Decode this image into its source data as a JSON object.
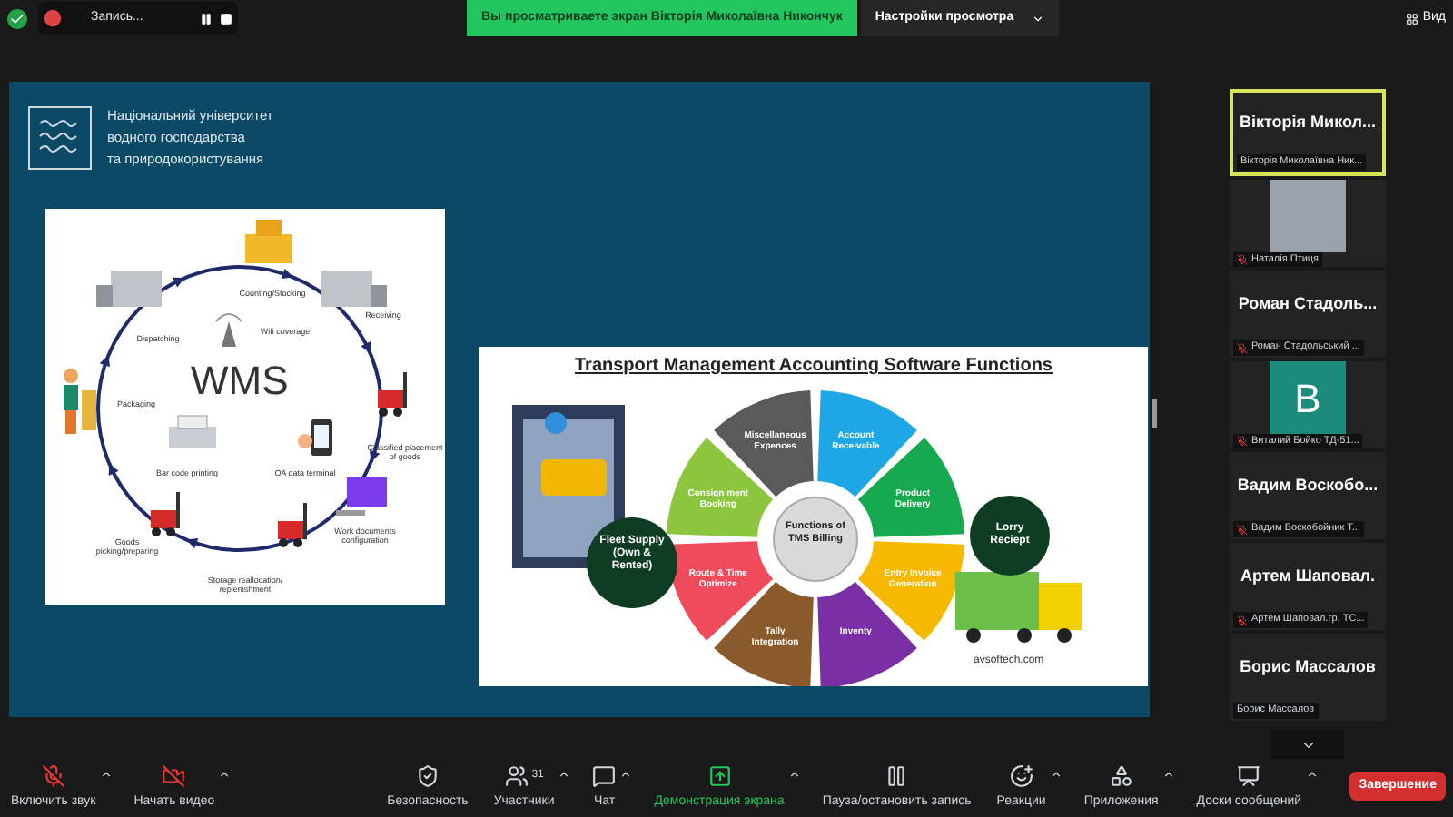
{
  "top_bar": {
    "recording": {
      "label": "Запись...",
      "paused": false
    },
    "banner": "Вы просматриваете экран Вікторія Миколаївна Никончук",
    "view_options": "Настройки просмотра",
    "view_button": "Вид"
  },
  "slide": {
    "university": [
      "Національний університет",
      "водного господарства",
      "та природокористування"
    ],
    "wms": {
      "title": "WMS",
      "labels": [
        "Counting/Stocking",
        "Receiving",
        "Wifi coverage",
        "Dispatching",
        "Packaging",
        "Classified placement of goods",
        "OA data terminal",
        "Bar code printing",
        "Work documents configuration",
        "Goods picking/preparing",
        "Storage reallocation/ replenishment"
      ]
    },
    "tms": {
      "title": "Transport Management Accounting Software Functions",
      "center": "Functions of TMS Billing",
      "segments": [
        {
          "label": "Miscellaneous Expences",
          "color": "#5a5a5a"
        },
        {
          "label": "Account Receivable",
          "color": "#1ea7e4"
        },
        {
          "label": "Consign ment Booking",
          "color": "#8cc63f"
        },
        {
          "label": "Product Delivery",
          "color": "#17a94f"
        },
        {
          "label": "Route & Time Optimize",
          "color": "#f04b5a"
        },
        {
          "label": "Entry Invoice Generation",
          "color": "#f7b900"
        },
        {
          "label": "Tally Integration",
          "color": "#8b5a2b"
        },
        {
          "label": "Inventy",
          "color": "#7a2fa5"
        }
      ],
      "fleet": "Fleet Supply (Own & Rented)",
      "lorry": "Lorry Reciept",
      "site": "avsoftech.com"
    }
  },
  "participants": [
    {
      "name": "Вікторія Микол...",
      "caption": "Вікторія Миколаївна Ник...",
      "kind": "name",
      "muted": false,
      "speaking": true
    },
    {
      "caption": "Наталія Птиця",
      "kind": "photo",
      "muted": true,
      "speaking": false
    },
    {
      "name": "Роман Стадоль...",
      "caption": "Роман Стадольський ...",
      "kind": "name",
      "muted": true,
      "speaking": false
    },
    {
      "letter": "В",
      "caption": "Виталий Бойко ТД-51...",
      "kind": "avatar",
      "muted": true,
      "speaking": false
    },
    {
      "name": "Вадим Воскобо...",
      "caption": "Вадим Воскобойник Т...",
      "kind": "name",
      "muted": true,
      "speaking": false
    },
    {
      "name": "Артем Шаповал.",
      "caption": "Артем Шаповал.гр. ТС...",
      "kind": "name",
      "muted": true,
      "speaking": false
    },
    {
      "name": "Борис Массалов",
      "caption": "Борис Массалов",
      "kind": "name",
      "muted": false,
      "speaking": false
    }
  ],
  "toolbar": {
    "left": [
      {
        "kind": "mic-off",
        "label": "Включить звук",
        "has_menu": true,
        "active": false
      },
      {
        "kind": "video-off",
        "label": "Начать видео",
        "has_menu": true,
        "active": false
      }
    ],
    "center": [
      {
        "kind": "security",
        "label": "Безопасность",
        "has_menu": false,
        "active": false
      },
      {
        "kind": "participants",
        "label": "Участники",
        "count": "31",
        "has_menu": true,
        "active": false
      },
      {
        "kind": "chat",
        "label": "Чат",
        "has_menu": true,
        "active": false
      },
      {
        "kind": "share",
        "label": "Демонстрация экрана",
        "has_menu": true,
        "active": true
      },
      {
        "kind": "record",
        "label": "Пауза/остановить запись",
        "has_menu": false,
        "active": false
      },
      {
        "kind": "reactions",
        "label": "Реакции",
        "has_menu": true,
        "active": false
      },
      {
        "kind": "apps",
        "label": "Приложения",
        "has_menu": true,
        "active": false
      },
      {
        "kind": "boards",
        "label": "Доски сообщений",
        "has_menu": true,
        "active": false
      }
    ],
    "end_button": "Завершение"
  }
}
